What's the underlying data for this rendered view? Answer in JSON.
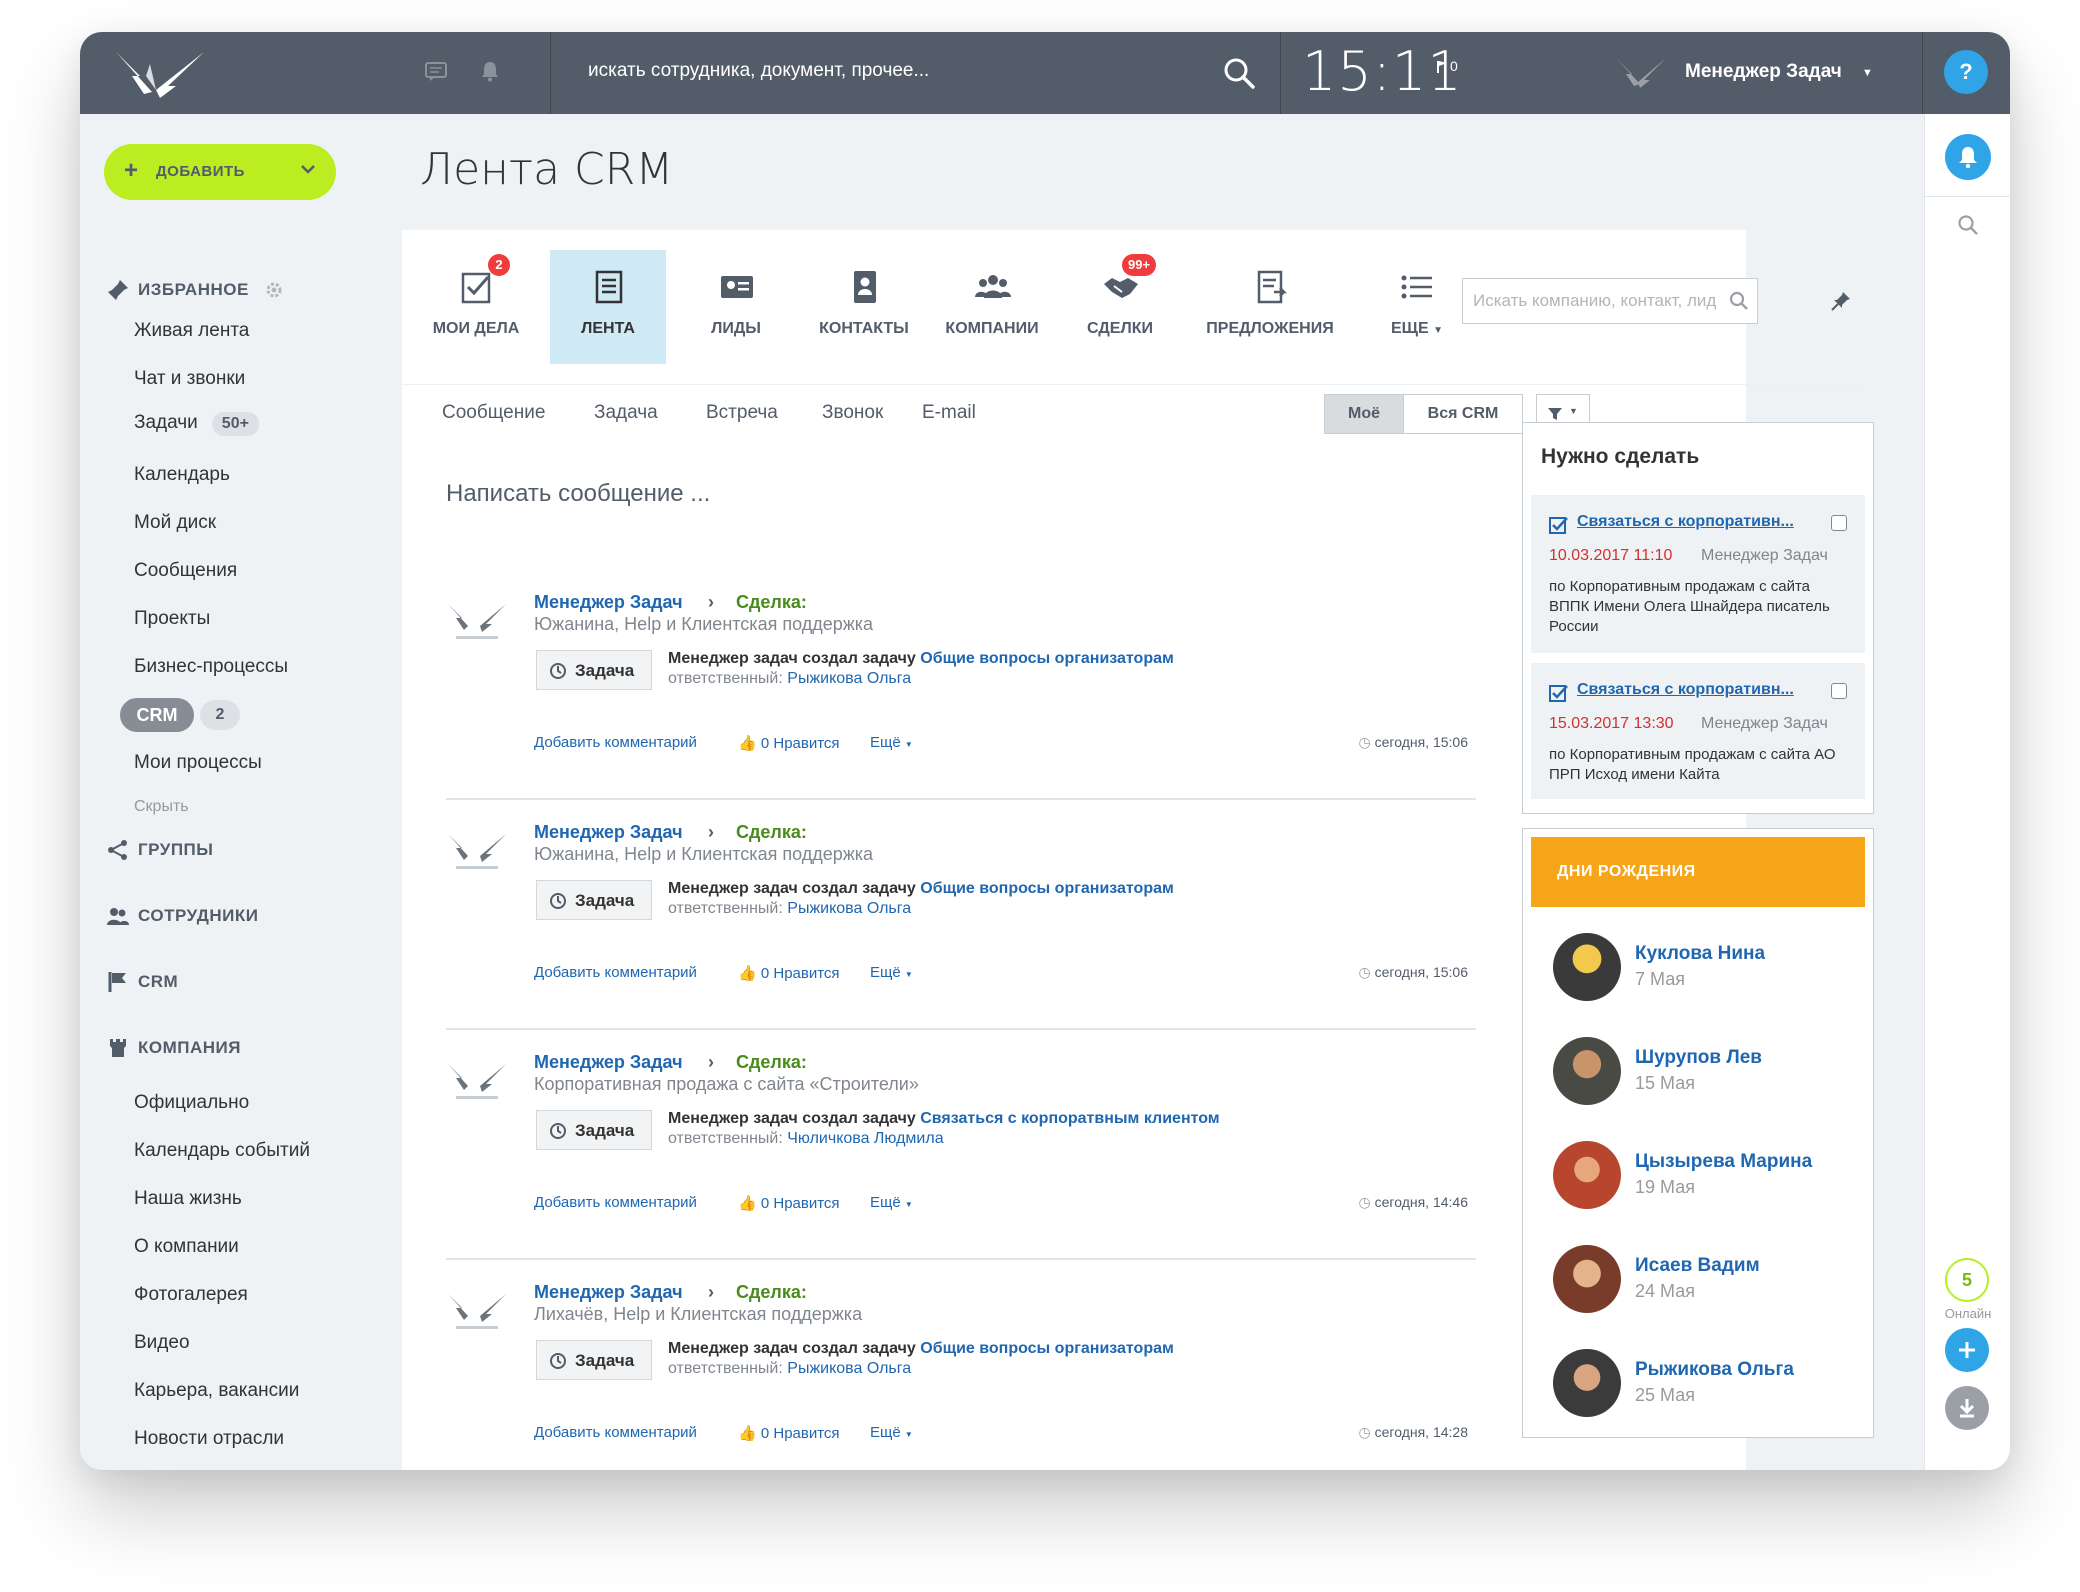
{
  "topbar": {
    "search_placeholder": "искать сотрудника, документ, прочее...",
    "clock": "15:11",
    "flag_count": "0",
    "user_name": "Менеджер Задач",
    "help": "?"
  },
  "sidebar": {
    "add_label": "ДОБАВИТЬ",
    "favorites_title": "ИЗБРАННОЕ",
    "items": [
      "Живая лента",
      "Чат и звонки",
      "Задачи",
      "Календарь",
      "Мой диск",
      "Сообщения",
      "Проекты",
      "Бизнес-процессы"
    ],
    "tasks_badge": "50+",
    "crm_pill": "CRM",
    "crm_count": "2",
    "my_processes": "Мои процессы",
    "hide": "Скрыть",
    "groups_title": "ГРУППЫ",
    "employees_title": "СОТРУДНИКИ",
    "crm_title": "CRM",
    "company_title": "КОМПАНИЯ",
    "company_items": [
      "Официально",
      "Календарь событий",
      "Наша жизнь",
      "О компании",
      "Фотогалерея",
      "Видео",
      "Карьера, вакансии",
      "Новости отрасли"
    ]
  },
  "page": {
    "title": "Лента CRM"
  },
  "crm_tabs": [
    {
      "label": "МОИ ДЕЛА",
      "badge": "2"
    },
    {
      "label": "ЛЕНТА",
      "badge": ""
    },
    {
      "label": "ЛИДЫ",
      "badge": ""
    },
    {
      "label": "КОНТАКТЫ",
      "badge": ""
    },
    {
      "label": "КОМПАНИИ",
      "badge": ""
    },
    {
      "label": "СДЕЛКИ",
      "badge": "99+"
    },
    {
      "label": "ПРЕДЛОЖЕНИЯ",
      "badge": ""
    },
    {
      "label": "ЕЩЕ",
      "badge": ""
    }
  ],
  "crm_search_placeholder": "Искать компанию, контакт, лид",
  "post_tabs": [
    "Сообщение",
    "Задача",
    "Встреча",
    "Звонок",
    "E-mail"
  ],
  "segment": {
    "mine": "Моё",
    "all": "Вся CRM"
  },
  "compose_placeholder": "Написать сообщение ...",
  "posts": [
    {
      "author": "Менеджер Задач",
      "deal_label": "Сделка:",
      "subtitle": "Южанина, Help и Клиентская поддержка",
      "badge": "Задача",
      "action_prefix": "Менеджер задач создал задачу",
      "action_link": "Общие вопросы организаторам",
      "resp_label": "ответственный:",
      "resp_name": "Рыжикова Ольга",
      "comment": "Добавить комментарий",
      "likes": "0 Нравится",
      "more": "Ещё",
      "time": "сегодня, 15:06"
    },
    {
      "author": "Менеджер Задач",
      "deal_label": "Сделка:",
      "subtitle": "Южанина, Help и Клиентская поддержка",
      "badge": "Задача",
      "action_prefix": "Менеджер задач создал задачу",
      "action_link": "Общие вопросы организаторам",
      "resp_label": "ответственный:",
      "resp_name": "Рыжикова Ольга",
      "comment": "Добавить комментарий",
      "likes": "0 Нравится",
      "more": "Ещё",
      "time": "сегодня, 15:06"
    },
    {
      "author": "Менеджер Задач",
      "deal_label": "Сделка:",
      "subtitle": "Корпоративная продажа с сайта «Строители»",
      "badge": "Задача",
      "action_prefix": "Менеджер задач создал задачу",
      "action_link": "Связаться с корпоратвным клиентом",
      "resp_label": "ответственный:",
      "resp_name": "Чюличкова Людмила",
      "comment": "Добавить комментарий",
      "likes": "0 Нравится",
      "more": "Ещё",
      "time": "сегодня, 14:46"
    },
    {
      "author": "Менеджер Задач",
      "deal_label": "Сделка:",
      "subtitle": "Лихачёв, Help и Клиентская поддержка",
      "badge": "Задача",
      "action_prefix": "Менеджер задач создал задачу",
      "action_link": "Общие вопросы организаторам",
      "resp_label": "ответственный:",
      "resp_name": "Рыжикова Ольга",
      "comment": "Добавить комментарий",
      "likes": "0 Нравится",
      "more": "Ещё",
      "time": "сегодня, 14:28"
    }
  ],
  "todo": {
    "title": "Нужно сделать",
    "items": [
      {
        "title": "Связаться с корпоративн...",
        "date": "10.03.2017 11:10",
        "owner": "Менеджер Задач",
        "desc": "по Корпоративным продажам с сайта ВППК Имени Олега Шнайдера писатель России"
      },
      {
        "title": "Связаться с корпоративн...",
        "date": "15.03.2017 13:30",
        "owner": "Менеджер Задач",
        "desc": "по Корпоративным продажам с сайта АО ПРП Исход имени Кайта"
      }
    ]
  },
  "birthdays": {
    "title": "ДНИ РОЖДЕНИЯ",
    "people": [
      {
        "name": "Куклова Нина",
        "date": "7 Мая"
      },
      {
        "name": "Шурупов Лев",
        "date": "15 Мая"
      },
      {
        "name": "Цызырева Марина",
        "date": "19 Мая"
      },
      {
        "name": "Исаев Вадим",
        "date": "24 Мая"
      },
      {
        "name": "Рыжикова Ольга",
        "date": "25 Мая"
      }
    ]
  },
  "rail": {
    "online_count": "5",
    "online_label": "Онлайн"
  },
  "colors": {
    "topbar": "#535c69",
    "accent_green": "#bbed21",
    "link_blue": "#2067b0",
    "bday_orange": "#f6a418",
    "badge_red": "#f03c3c",
    "rail_blue": "#2fa4e7"
  }
}
